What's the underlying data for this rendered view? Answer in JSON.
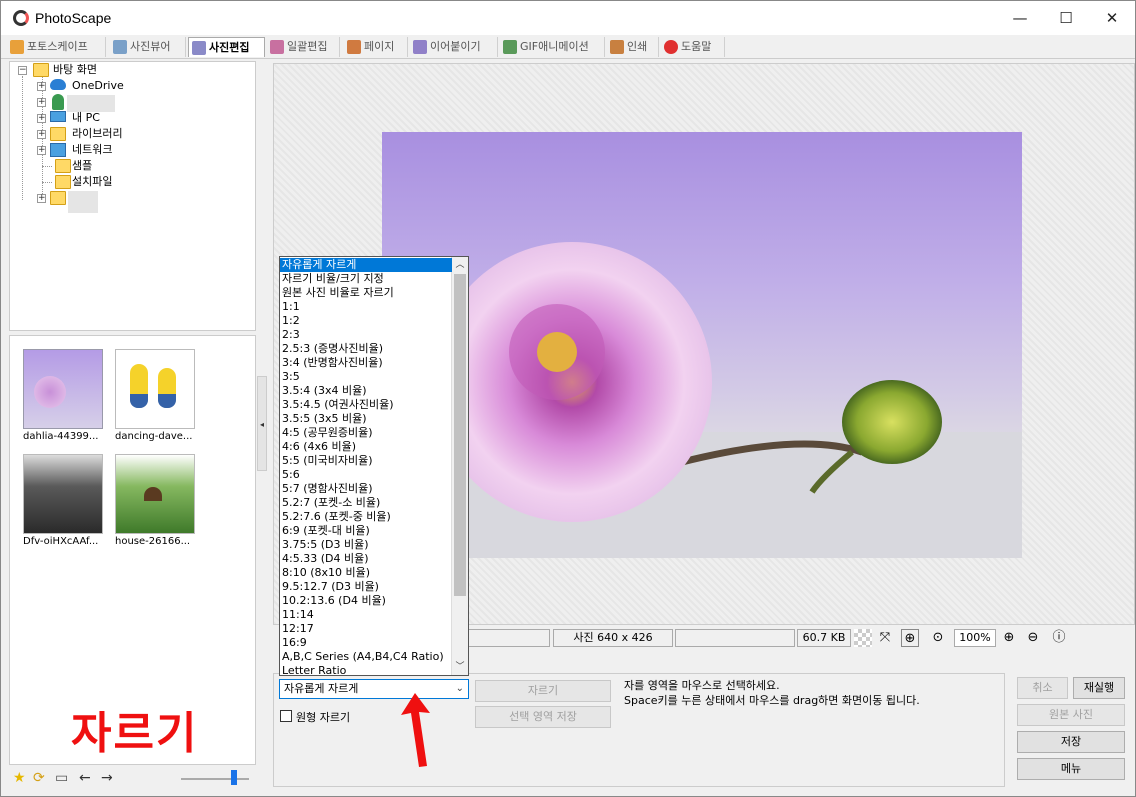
{
  "app": {
    "title": "PhotoScape"
  },
  "window_controls": {
    "minimize": "—",
    "maximize": "☐",
    "close": "✕"
  },
  "tabs": [
    {
      "label": "포토스케이프",
      "color": "#e8a03a"
    },
    {
      "label": "사진뷰어",
      "color": "#7aa0c8"
    },
    {
      "label": "사진편집",
      "color": "#8a8ac8",
      "active": true
    },
    {
      "label": "일괄편집",
      "color": "#c870a0"
    },
    {
      "label": "페이지",
      "color": "#d07a40"
    },
    {
      "label": "이어붙이기",
      "color": "#9080c8"
    },
    {
      "label": "GIF애니메이션",
      "color": "#5a9a5a"
    },
    {
      "label": "인쇄",
      "color": "#c88040"
    },
    {
      "label": "도움말",
      "color": "#e03030"
    }
  ],
  "tree": {
    "root": "바탕 화면",
    "items": [
      "OneDrive",
      "내 PC",
      "라이브러리",
      "네트워크",
      "샘플",
      "설치파일"
    ]
  },
  "thumbnails": [
    {
      "label": "dahlia-44399..."
    },
    {
      "label": "dancing-dave..."
    },
    {
      "label": "Dfv-oiHXcAAf..."
    },
    {
      "label": "house-26166..."
    }
  ],
  "status": {
    "photo_info": "사진 640 x 426",
    "file_size": "60.7 KB",
    "zoom": "100%"
  },
  "crop": {
    "options": [
      "자유롭게 자르게",
      "자르기 비율/크기 지정",
      "원본 사진 비율로 자르기",
      "1:1",
      "1:2",
      "2:3",
      "2.5:3 (증명사진비율)",
      "3:4 (반명함사진비율)",
      "3:5",
      "3.5:4 (3x4 비율)",
      "3.5:4.5 (여권사진비율)",
      "3.5:5 (3x5 비율)",
      "4:5 (공무원증비율)",
      "4:6 (4x6 비율)",
      "5:5 (미국비자비율)",
      "5:6",
      "5:7 (명함사진비율)",
      "5.2:7 (포켓-소 비율)",
      "5.2:7.6 (포켓-중 비율)",
      "6:9 (포켓-대 비율)",
      "3.75:5 (D3 비율)",
      "4:5.33 (D4 비율)",
      "8:10 (8x10 비율)",
      "9.5:12.7 (D3 비율)",
      "10.2:13.6 (D4 비율)",
      "11:14",
      "12:17",
      "16:9",
      "A,B,C Series (A4,B4,C4 Ratio)",
      "Letter Ratio"
    ],
    "selected": "자유롭게 자르게",
    "circle_crop_label": "원형 자르기",
    "crop_button": "자르기",
    "save_selection_button": "선택 영역 저장",
    "hint_line1": "자를 영역을 마우스로 선택하세요.",
    "hint_line2": "Space키를 누른 상태에서 마우스를 drag하면 화면이동 됩니다."
  },
  "actions": {
    "undo": "취소",
    "redo": "재실행",
    "original": "원본 사진",
    "save": "저장",
    "menu": "메뉴"
  },
  "annotation": {
    "caption": "자르기",
    "caption_color": "#ef1010"
  }
}
